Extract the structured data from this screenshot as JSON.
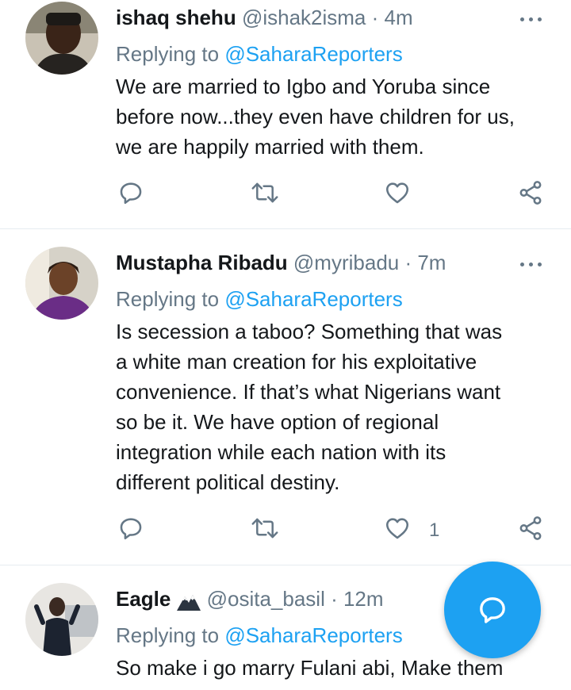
{
  "tweets": [
    {
      "name": "ishaq shehu",
      "handle": "@ishak2isma",
      "time": "4m",
      "reply_prefix": "Replying to ",
      "reply_handle": "@SaharaReporters",
      "text_lines": [
        "We are married to Igbo and Yoruba since",
        "before now...they even have children for us,",
        "we are happily married with them."
      ],
      "like_count": "",
      "avatar_icon": "user-avatar"
    },
    {
      "name": "Mustapha Ribadu",
      "handle": "@myribadu",
      "time": "7m",
      "reply_prefix": "Replying to ",
      "reply_handle": "@SaharaReporters",
      "text_lines": [
        "Is secession a taboo? Something that was",
        "a white man creation for his exploitative",
        "convenience. If that’s what Nigerians want",
        "so be it. We have option of regional",
        "integration while each nation with its",
        "different political destiny."
      ],
      "like_count": "1",
      "avatar_icon": "user-avatar"
    },
    {
      "name": "Eagle",
      "name_emoji": "mountain-emoji",
      "handle": "@osita_basil",
      "time": "12m",
      "reply_prefix": "Replying to ",
      "reply_handle": "@SaharaReporters",
      "text_lines": [
        "So make i go marry Fulani abi, Make them"
      ],
      "avatar_icon": "user-avatar"
    }
  ],
  "separator": " · ",
  "icons": [
    "reply-icon",
    "retweet-icon",
    "like-icon",
    "share-icon",
    "more-icon",
    "compose-reply-icon"
  ],
  "colors": {
    "accent": "#1da1f2",
    "secondary_text": "#657786",
    "divider": "#e6ecf0"
  }
}
